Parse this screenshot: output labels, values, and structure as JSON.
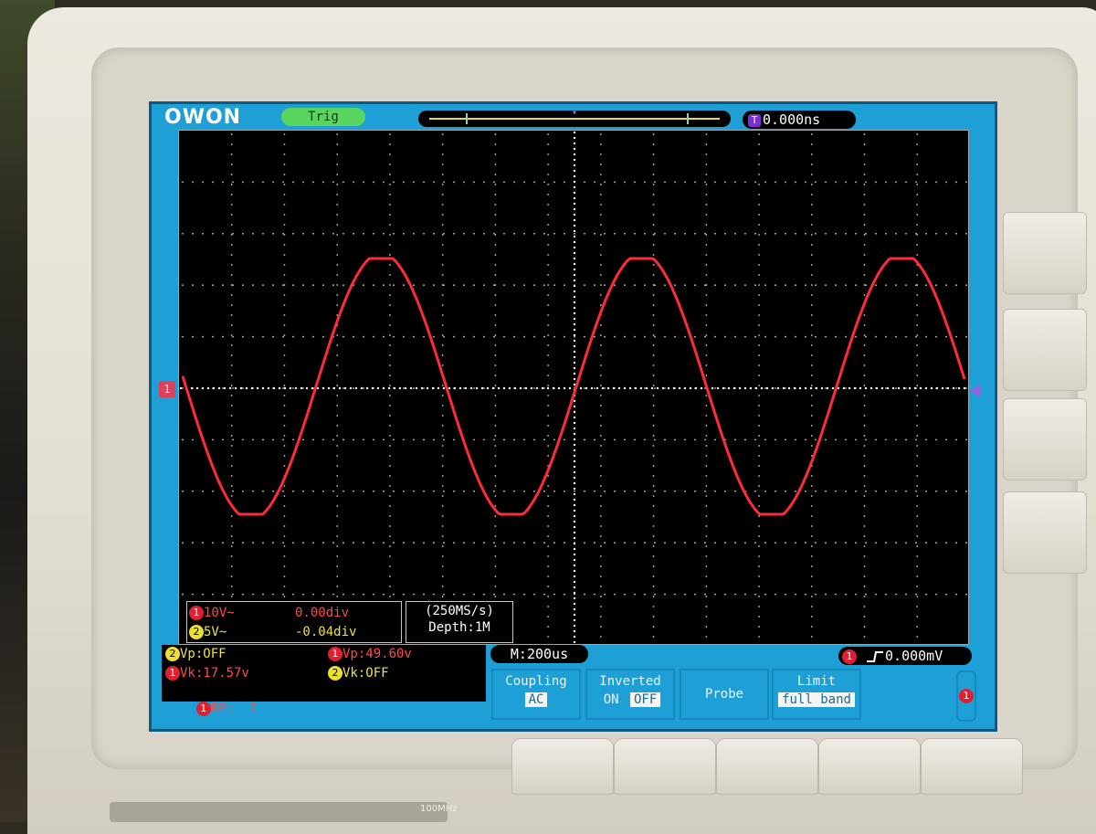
{
  "header": {
    "brand": "OWON",
    "status": "Trig",
    "trigger_offset": "0.000ns",
    "trigger_marker": "T"
  },
  "channel_marker": "1",
  "channels": [
    {
      "num": "1",
      "scale": "10V~",
      "offset": "0.00div",
      "color": "#e02030"
    },
    {
      "num": "2",
      "scale": "5V~",
      "offset": "-0.04div",
      "color": "#ece02a"
    }
  ],
  "acquisition": {
    "rate": "(250MS/s)",
    "depth": "Depth:1M"
  },
  "measurements": {
    "ch2_vp": {
      "num": "2",
      "text": "Vp:OFF"
    },
    "ch1_vp": {
      "num": "1",
      "text": "Vp:49.60v"
    },
    "ch1_vk": {
      "num": "1",
      "text": "Vk:17.57v"
    },
    "ch2_vk": {
      "num": "2",
      "text": "Vk:OFF"
    },
    "ch1_rp": {
      "num": "1",
      "text": "RP:  ?"
    }
  },
  "timebase": "M:200us",
  "trigger_level": {
    "num": "1",
    "text": "0.000mV"
  },
  "menu": {
    "coupling": {
      "title": "Coupling",
      "value": "AC"
    },
    "inverted": {
      "title": "Inverted",
      "on": "ON",
      "off": "OFF"
    },
    "probe": {
      "title": "Probe"
    },
    "limit": {
      "title": "Limit",
      "value": "full band"
    }
  },
  "side_channel": "1",
  "model_label": "100MHz",
  "colors": {
    "screen_bg": "#1e9fd6",
    "trace": "#ff2b3a",
    "grid_dots": "#c8c8c8",
    "trig_pill": "#58d55e"
  }
}
